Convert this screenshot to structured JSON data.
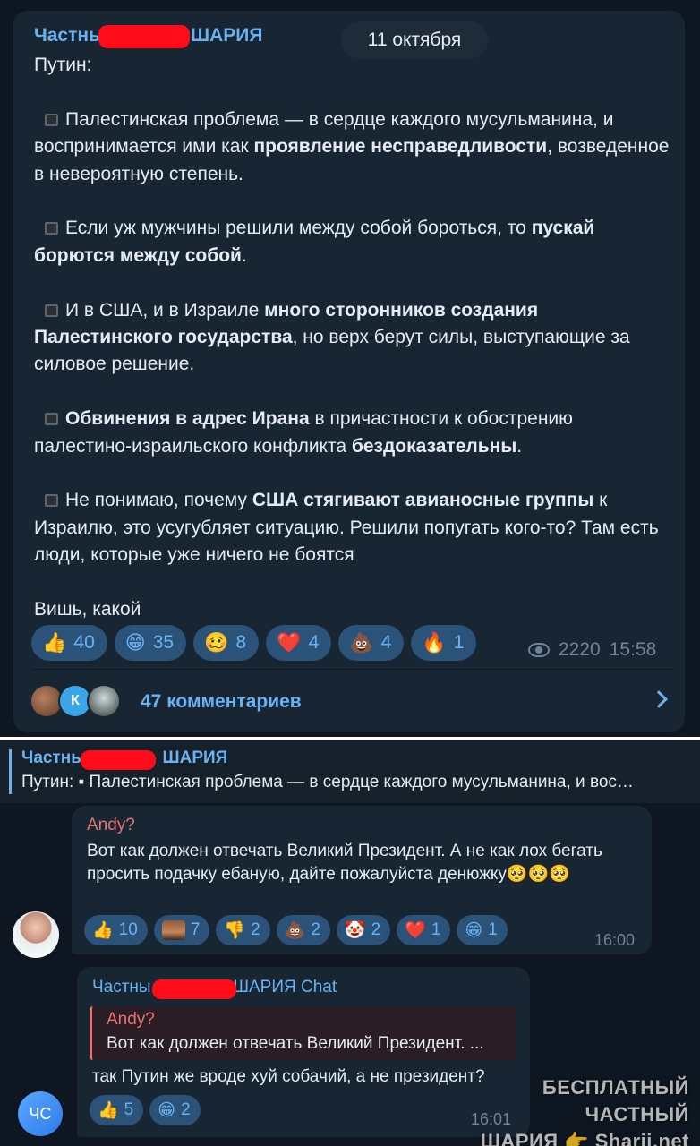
{
  "post": {
    "author_prefix": "Частны",
    "author_suffix": "ШАРИЯ",
    "date": "11 октября",
    "intro": "Путин:",
    "p1_a": "Палестинская проблема — в сердце каждого мусульманина, и воспринимается ими как ",
    "p1_b": "проявление несправедливости",
    "p1_c": ", возведенное в невероятную степень.",
    "p2_a": "Если уж мужчины решили между собой бороться, то ",
    "p2_b": "пускай борются между собой",
    "p2_c": ".",
    "p3_a": "И в США, и в Израиле ",
    "p3_b": "много сторонников создания Палестинского государства",
    "p3_c": ", но верх берут силы, выступающие за силовое решение.",
    "p4_a": "Обвинения в адрес Ирана",
    "p4_b": " в причастности к обострению палестино-израильского конфликта ",
    "p4_c": "бездоказательны",
    "p4_d": ".",
    "p5_a": "Не понимаю, почему ",
    "p5_b": "США стягивают авианосные группы",
    "p5_c": " к Израилю, это усугубляет ситуацию. Решили попугать кого-то? Там есть люди, которые уже ничего не боятся",
    "outro": "Вишь, какой",
    "reactions": [
      {
        "emoji": "👍",
        "count": "40"
      },
      {
        "emoji": "😁",
        "count": "35"
      },
      {
        "emoji": "🥴",
        "count": "8"
      },
      {
        "emoji": "❤️",
        "count": "4"
      },
      {
        "emoji": "💩",
        "count": "4"
      },
      {
        "emoji": "🔥",
        "count": "1"
      }
    ],
    "views": "2220",
    "time": "15:58",
    "comments_avatar_letter": "К",
    "comments_label": "47 комментариев"
  },
  "pinned": {
    "author_prefix": "Частны",
    "author_suffix": "ШАРИЯ",
    "preview": "Путин: ▪ Палестинская проблема — в сердце каждого мусульманина, и вос…"
  },
  "comment1": {
    "author": "Andy?",
    "text": "Вот как должен отвечать Великий Президент. А не как лох бегать просить подачку ебаную, дайте пожалуйста денюжку🥺🥺🥺",
    "reactions": [
      {
        "emoji": "👍",
        "count": "10"
      },
      {
        "emoji": "",
        "count": "7"
      },
      {
        "emoji": "👎",
        "count": "2"
      },
      {
        "emoji": "💩",
        "count": "2"
      },
      {
        "emoji": "🤡",
        "count": "2"
      },
      {
        "emoji": "❤️",
        "count": "1"
      },
      {
        "emoji": "😁",
        "count": "1"
      }
    ],
    "time": "16:00"
  },
  "comment2": {
    "author_prefix": "Частны",
    "author_suffix": "ШАРИЯ Chat",
    "quote_author": "Andy?",
    "quote_text": "Вот как должен отвечать Великий Президент. ...",
    "text": "так Путин же вроде хуй собачий, а не президент?",
    "reactions": [
      {
        "emoji": "👍",
        "count": "5"
      },
      {
        "emoji": "😁",
        "count": "2"
      }
    ],
    "time": "16:01",
    "avatar_initials": "ЧС"
  },
  "watermark": {
    "line1": "БЕСПЛАТНЫЙ ЧАСТНЫЙ",
    "line2": "ШАРИЯ 👉 Sharij.net"
  },
  "colors": {
    "background": "#0e1621",
    "bubble": "#182533",
    "accent": "#6ab3f3",
    "reaction_bg": "#2b5278",
    "redaction": "#ff0b1a",
    "andy_name": "#e57373"
  }
}
